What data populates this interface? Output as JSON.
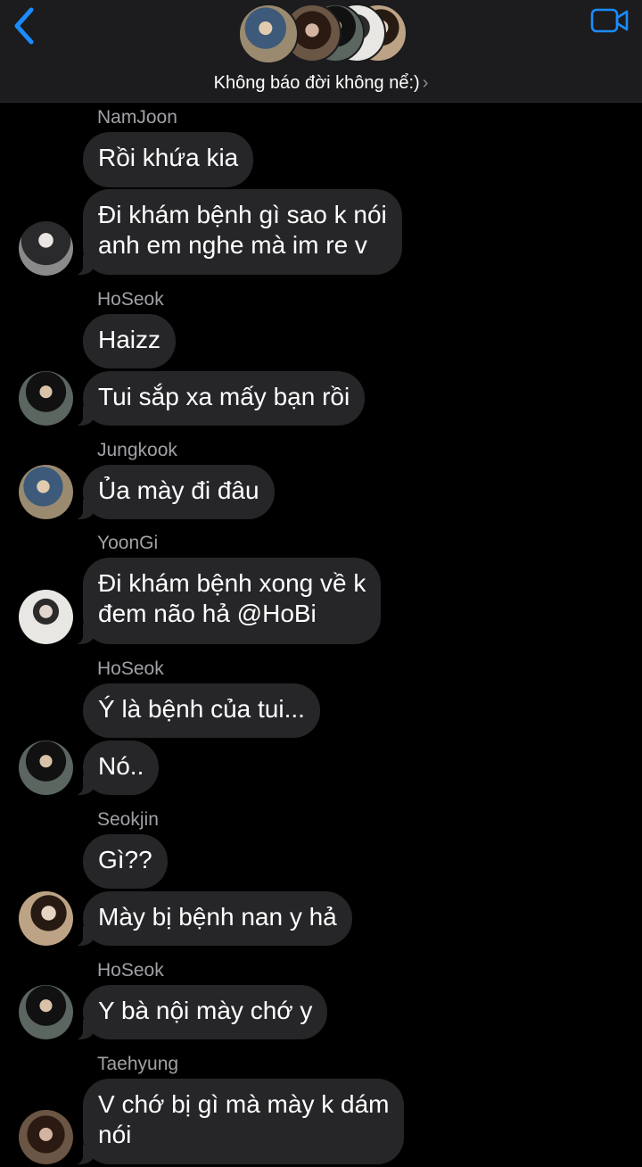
{
  "header": {
    "group_name": "Không báo đời không nể:)",
    "chevron": "›",
    "back_icon": "chevron-left-icon",
    "call_icon": "video-camera-icon",
    "accent_color": "#1a8cff"
  },
  "messages": [
    {
      "sender": "NamJoon",
      "bubbles": [
        "Rồi khứa kia",
        "Đi khám bệnh gì sao k nói\nanh em nghe mà im re v"
      ]
    },
    {
      "sender": "HoSeok",
      "bubbles": [
        "Haizz",
        "Tui sắp xa mấy bạn rồi"
      ]
    },
    {
      "sender": "Jungkook",
      "bubbles": [
        "Ủa mày đi đâu"
      ]
    },
    {
      "sender": "YoonGi",
      "bubbles": [
        "Đi khám bệnh xong về k\nđem não hả @HoBi"
      ]
    },
    {
      "sender": "HoSeok",
      "bubbles": [
        "Ý là bệnh của tui...",
        "Nó.."
      ]
    },
    {
      "sender": "Seokjin",
      "bubbles": [
        "Gì??",
        "Mày bị bệnh nan y hả"
      ]
    },
    {
      "sender": "HoSeok",
      "bubbles": [
        "Y bà nội mày chớ y"
      ]
    },
    {
      "sender": "Taehyung",
      "bubbles": [
        "V chớ bị gì mà mày k dám\nnói"
      ]
    }
  ]
}
